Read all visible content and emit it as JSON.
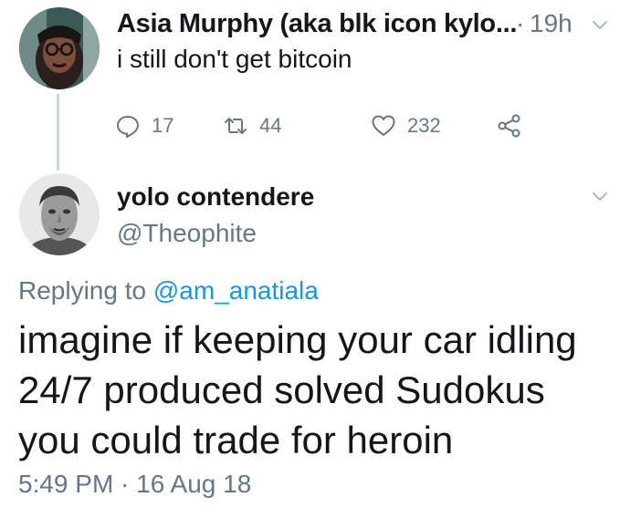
{
  "tweet1": {
    "author_name": "Asia Murphy (aka blk icon kylo...",
    "separator": "·",
    "time": "19h",
    "text": "i still don't get bitcoin",
    "actions": {
      "reply_icon": "reply-icon",
      "reply_count": "17",
      "retweet_icon": "retweet-icon",
      "retweet_count": "44",
      "like_icon": "heart-icon",
      "like_count": "232",
      "share_icon": "share-icon"
    }
  },
  "tweet2": {
    "author_name": "yolo contendere",
    "handle": "@Theophite",
    "replying_prefix": "Replying to",
    "replying_mention": "@am_anatiala",
    "body_lines": [
      "imagine if keeping your car idling",
      "24/7 produced solved Sudokus",
      "you could trade for heroin"
    ],
    "timestamp": "5:49 PM · 16 Aug 18"
  },
  "colors": {
    "text": "#14171a",
    "secondary": "#657786",
    "link": "#1b95e0",
    "thread_line": "#ccd6dd",
    "background": "#ffffff"
  }
}
